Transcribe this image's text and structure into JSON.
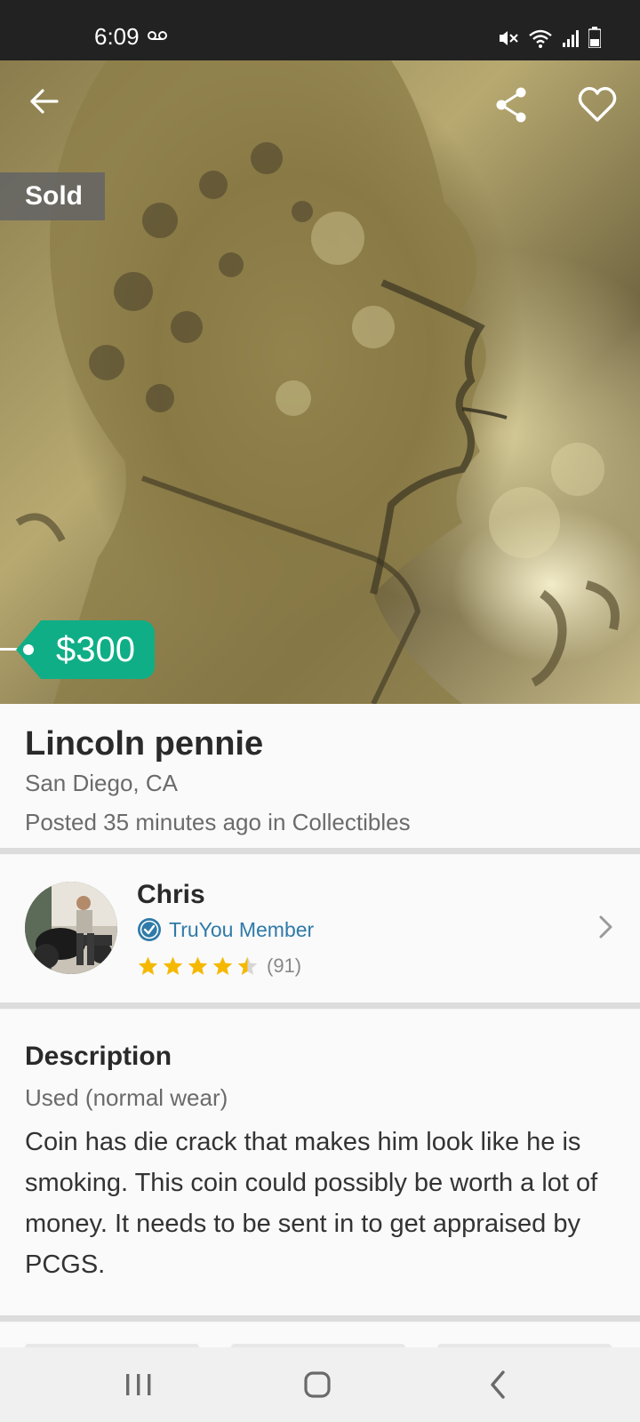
{
  "status_bar": {
    "time": "6:09",
    "icons": [
      "voicemail-icon",
      "mute-icon",
      "wifi-icon",
      "signal-icon",
      "battery-icon"
    ]
  },
  "header": {
    "back_icon": "arrow-left-icon",
    "share_icon": "share-icon",
    "favorite_icon": "heart-icon"
  },
  "listing": {
    "status_badge": "Sold",
    "price": "$300",
    "title": "Lincoln pennie",
    "location": "San Diego, CA",
    "posted": "Posted 35 minutes ago in Collectibles"
  },
  "seller": {
    "name": "Chris",
    "badge": "TruYou Member",
    "rating": 4.5,
    "review_count": "(91)"
  },
  "description": {
    "heading": "Description",
    "condition": "Used (normal wear)",
    "body": "Coin has die crack that makes him look like he is smoking. This coin could possibly be worth a lot of money. It needs to be sent in to get appraised by PCGS."
  },
  "nav_bar": {
    "icons": [
      "recent-apps-icon",
      "home-icon",
      "back-icon"
    ]
  },
  "colors": {
    "price_tag": "#0fae86",
    "member_blue": "#2f7aa8",
    "star": "#f5b800"
  }
}
